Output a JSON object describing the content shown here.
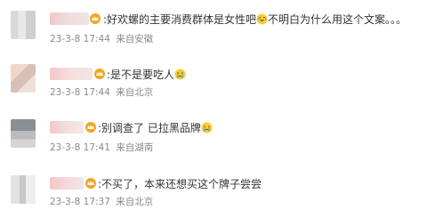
{
  "comments": [
    {
      "text_before": ":好欢螺的主要消费群体是女性吧",
      "text_after": "不明白为什么用这个文案。。。",
      "emoji": "laughing-tears-emoji-icon",
      "time": "23-3-8 17:44",
      "location": "来自安徽"
    },
    {
      "text_before": ":是不是要吃人",
      "text_after": "",
      "emoji": "crying-emoji-icon",
      "time": "23-3-8 17:44",
      "location": "来自北京"
    },
    {
      "text_before": ":别调查了 已拉黑品牌",
      "text_after": "",
      "emoji": "crying-emoji-icon",
      "time": "23-3-8 17:41",
      "location": "来自湖南"
    },
    {
      "text_before": ":不买了，本来还想买这个牌子尝尝",
      "text_after": "",
      "emoji": "",
      "time": "23-3-8 17:37",
      "location": "来自北京"
    }
  ],
  "colors": {
    "text": "#333333",
    "meta": "#8a8a8a",
    "crown": "#f5a623"
  }
}
